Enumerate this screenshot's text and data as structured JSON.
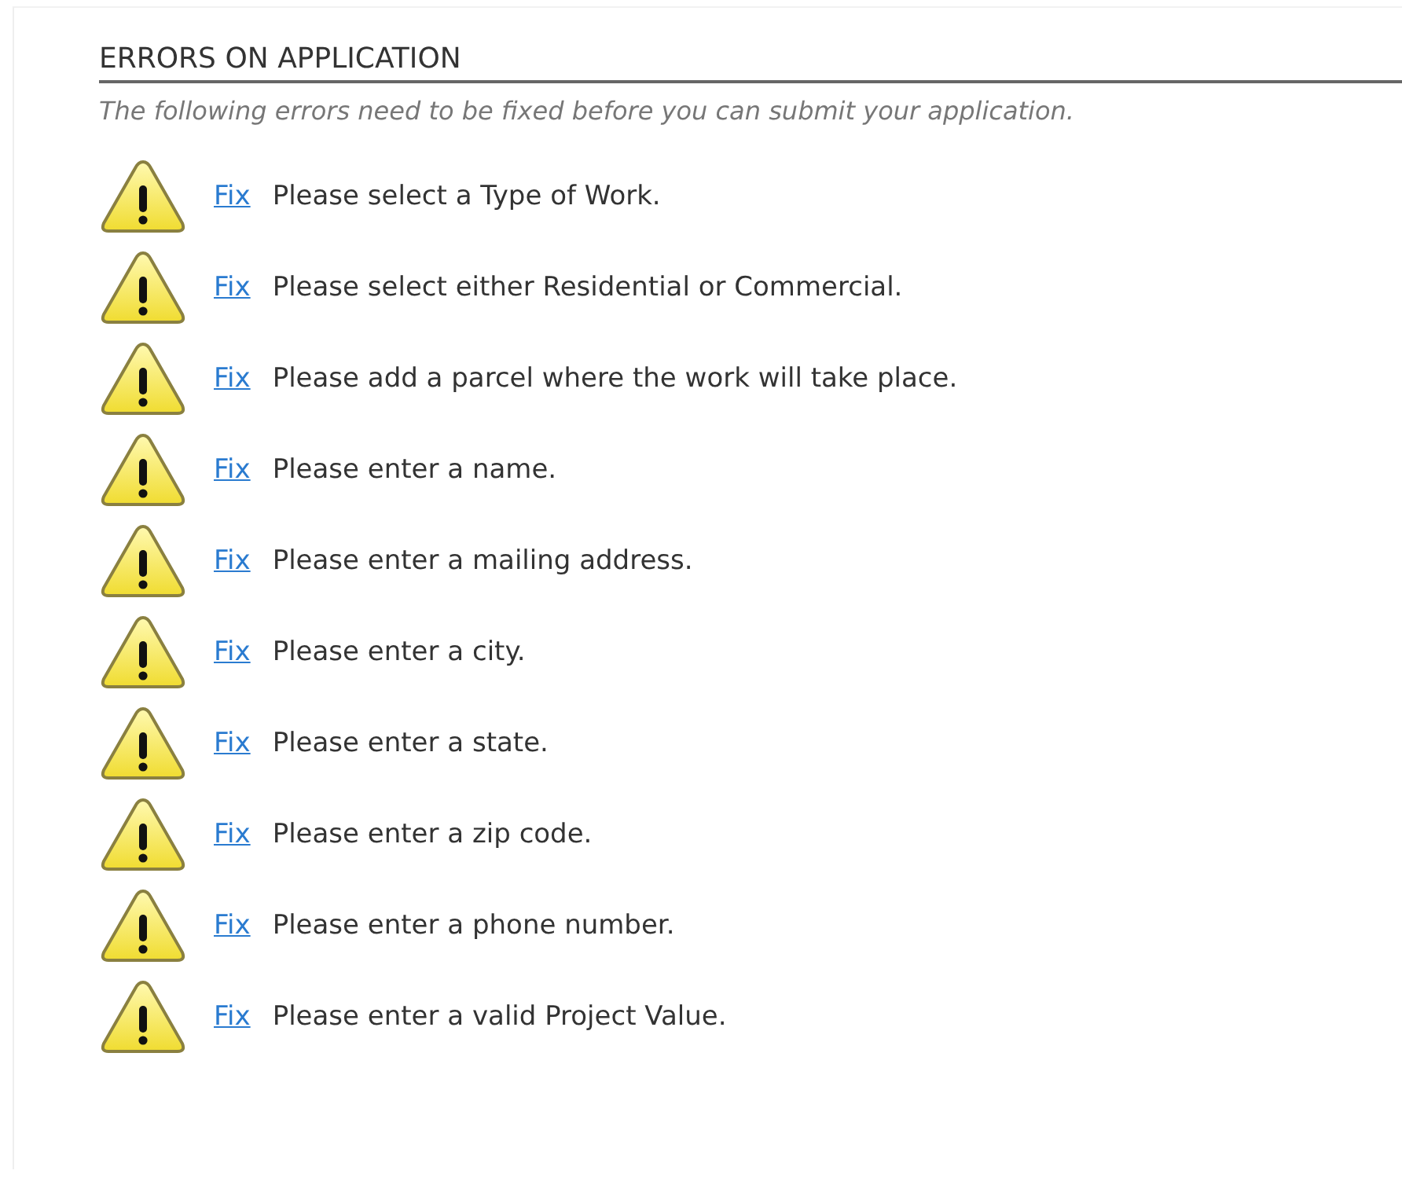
{
  "section": {
    "title": "ERRORS ON APPLICATION",
    "subtitle": "The following errors need to be fixed before you can submit your application."
  },
  "errors": [
    {
      "link": "Fix",
      "message": "Please select a Type of Work."
    },
    {
      "link": "Fix",
      "message": "Please select either Residential or Commercial."
    },
    {
      "link": "Fix",
      "message": "Please add a parcel where the work will take place."
    },
    {
      "link": "Fix",
      "message": "Please enter a name."
    },
    {
      "link": "Fix",
      "message": "Please enter a mailing address."
    },
    {
      "link": "Fix",
      "message": "Please enter a city."
    },
    {
      "link": "Fix",
      "message": "Please enter a state."
    },
    {
      "link": "Fix",
      "message": "Please enter a zip code."
    },
    {
      "link": "Fix",
      "message": "Please enter a phone number."
    },
    {
      "link": "Fix",
      "message": "Please enter a valid Project Value."
    }
  ]
}
